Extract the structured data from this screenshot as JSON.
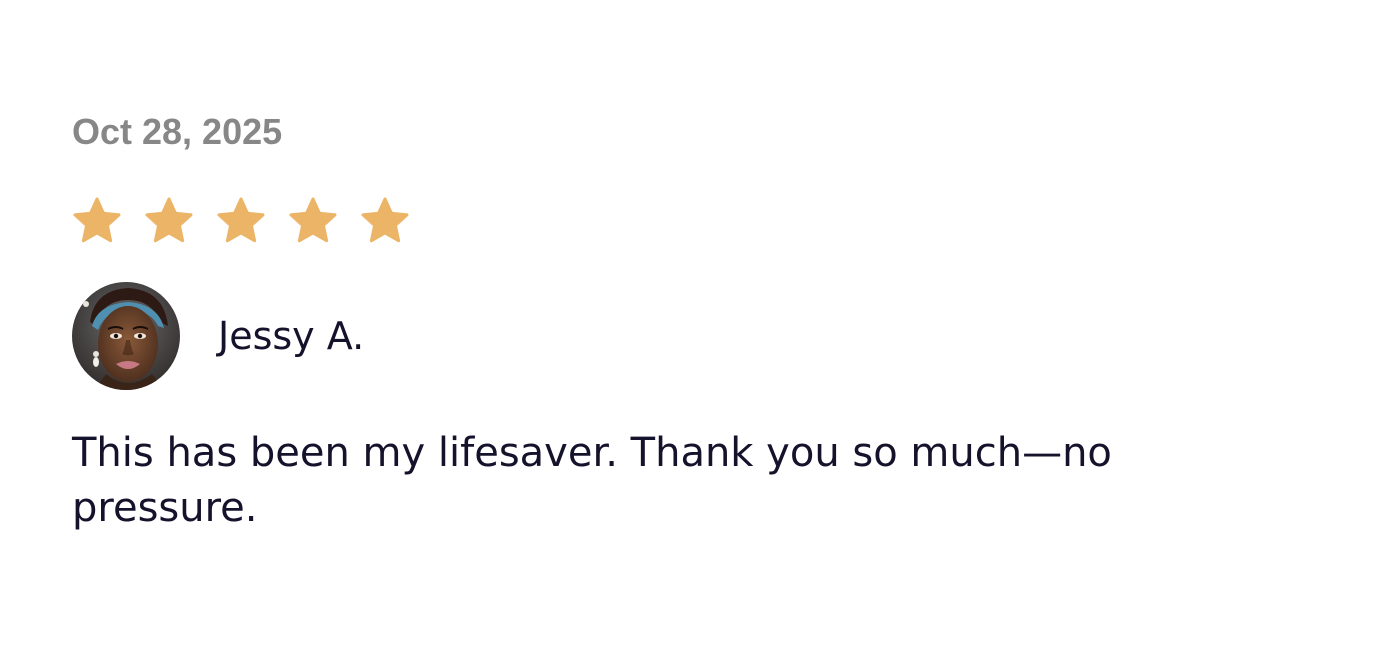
{
  "review": {
    "date": "Oct 28, 2025",
    "rating": 5,
    "rating_max": 5,
    "author": {
      "name": "Jessy A.",
      "avatar_icon": "user-photo"
    },
    "text": "This has been my lifesaver. Thank you so much—no pressure."
  },
  "colors": {
    "star": "#ECB466",
    "date": "#878787",
    "text": "#15122B",
    "background": "#FFFFFF"
  }
}
